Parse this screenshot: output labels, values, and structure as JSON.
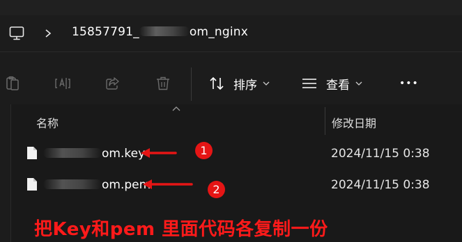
{
  "address_bar": {
    "path_prefix": "15857791_",
    "path_suffix": "om_nginx",
    "icons": [
      "computer-icon",
      "chevron-right-icon"
    ]
  },
  "toolbar": {
    "icons": [
      "clipboard-icon",
      "rename-icon",
      "share-icon",
      "trash-icon"
    ],
    "sort_label": "排序",
    "view_label": "查看",
    "more_label": "•••"
  },
  "file_list": {
    "columns": {
      "name": "名称",
      "date_modified": "修改日期"
    },
    "files": [
      {
        "name_suffix": "om.key",
        "date": "2024/11/15 0:38",
        "annotation_number": "1"
      },
      {
        "name_suffix": "om.pem",
        "date": "2024/11/15 0:38",
        "annotation_number": "2"
      }
    ]
  },
  "annotation": {
    "caption": "把Key和pem 里面代码各复制一份",
    "color": "#ff1a1a"
  }
}
